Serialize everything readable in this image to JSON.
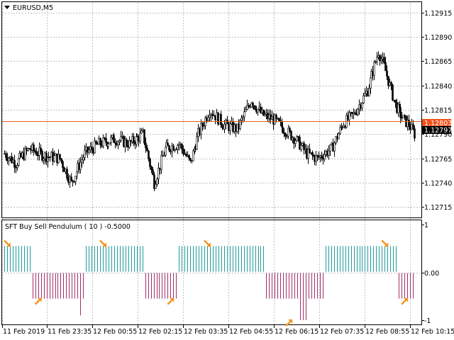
{
  "window": {
    "symbol_label": "EURUSD,M5",
    "dropdown_icon": "triangle-down-icon"
  },
  "colors": {
    "bull_hist": "#1f9a9a",
    "bear_hist": "#a0306a",
    "arrow": "#f5931e",
    "current_line": "#e0601a",
    "bid_box": "#f0501a",
    "last_box": "#000000",
    "grid": "#c0c0c0",
    "candle": "#000000"
  },
  "price_chart": {
    "y_ticks": [
      "1.12915",
      "1.12890",
      "1.12865",
      "1.12840",
      "1.12815",
      "1.12790",
      "1.12765",
      "1.12740",
      "1.12715"
    ],
    "current_price": "1.12803",
    "last_price": "1.12797"
  },
  "indicator": {
    "title": "SFT Buy Sell Pendulum ( 10 ) -0.5000",
    "y_ticks": [
      "1",
      "0.00",
      "-1"
    ]
  },
  "time_axis": {
    "labels": [
      "11 Feb 2019",
      "11 Feb 23:35",
      "12 Feb 00:55",
      "12 Feb 02:15",
      "12 Feb 03:35",
      "12 Feb 04:55",
      "12 Feb 06:15",
      "12 Feb 07:35",
      "12 Feb 08:55",
      "12 Feb 10:15"
    ]
  },
  "chart_data": [
    {
      "type": "candlestick",
      "title": "EURUSD,M5",
      "x_start": "11 Feb 2019",
      "x_end": "12 Feb 10:15",
      "ylim": [
        1.12705,
        1.12925
      ],
      "close_path": [
        [
          0,
          1.1277
        ],
        [
          8,
          1.1276
        ],
        [
          18,
          1.12775
        ],
        [
          28,
          1.12768
        ],
        [
          40,
          1.12765
        ],
        [
          48,
          1.1274
        ],
        [
          58,
          1.1277
        ],
        [
          68,
          1.1278
        ],
        [
          80,
          1.12785
        ],
        [
          90,
          1.1278
        ],
        [
          100,
          1.1279
        ],
        [
          108,
          1.1274
        ],
        [
          116,
          1.12775
        ],
        [
          126,
          1.1278
        ],
        [
          134,
          1.1276
        ],
        [
          140,
          1.1279
        ],
        [
          148,
          1.12815
        ],
        [
          158,
          1.128
        ],
        [
          168,
          1.12795
        ],
        [
          178,
          1.12825
        ],
        [
          186,
          1.1281
        ],
        [
          194,
          1.12805
        ],
        [
          202,
          1.12795
        ],
        [
          210,
          1.12785
        ],
        [
          218,
          1.1277
        ],
        [
          226,
          1.12765
        ],
        [
          236,
          1.12775
        ],
        [
          244,
          1.128
        ],
        [
          252,
          1.1281
        ],
        [
          262,
          1.12835
        ],
        [
          270,
          1.12875
        ],
        [
          274,
          1.1286
        ],
        [
          282,
          1.1282
        ],
        [
          288,
          1.12805
        ],
        [
          292,
          1.128
        ],
        [
          296,
          1.1279
        ]
      ],
      "current_price": 1.12803,
      "last_price": 1.12797
    },
    {
      "type": "bar",
      "title": "SFT Buy Sell Pendulum ( 10 ) -0.5000",
      "ylim": [
        -1,
        1
      ],
      "segments": [
        {
          "start_bar": 0,
          "end_bar": 9,
          "value": 1
        },
        {
          "start_bar": 10,
          "end_bar": 28,
          "value": -1
        },
        {
          "start_bar": 29,
          "end_bar": 49,
          "value": 1
        },
        {
          "start_bar": 50,
          "end_bar": 61,
          "value": -1
        },
        {
          "start_bar": 62,
          "end_bar": 92,
          "value": 1
        },
        {
          "start_bar": 93,
          "end_bar": 113,
          "value": -1
        },
        {
          "start_bar": 114,
          "end_bar": 139,
          "value": 1
        },
        {
          "start_bar": 140,
          "end_bar": 145,
          "value": -1
        }
      ],
      "signals": [
        {
          "bar": 1,
          "dir": "down"
        },
        {
          "bar": 12,
          "dir": "up"
        },
        {
          "bar": 35,
          "dir": "down"
        },
        {
          "bar": 59,
          "dir": "up"
        },
        {
          "bar": 72,
          "dir": "down"
        },
        {
          "bar": 101,
          "dir": "up"
        },
        {
          "bar": 135,
          "dir": "down"
        },
        {
          "bar": 142,
          "dir": "up"
        }
      ]
    }
  ]
}
